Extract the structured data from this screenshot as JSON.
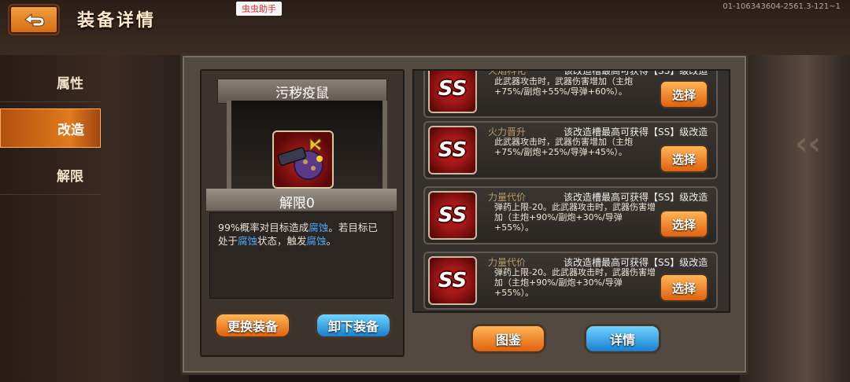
{
  "header": {
    "title": "装备详情",
    "back_icon": "return-arrow-icon",
    "helper_badge": "虫虫助手",
    "device_id": "01-106343604-2561.3-121~1"
  },
  "sidebar": {
    "tabs": [
      {
        "label": "属性",
        "active": false
      },
      {
        "label": "改造",
        "active": true
      },
      {
        "label": "解限",
        "active": false
      }
    ]
  },
  "equipment": {
    "name": "污秽疫鼠",
    "limit_break": "解限0",
    "description_parts": [
      "99%概率对目标造成",
      "腐蚀",
      "。若目标已处于",
      "腐蚀",
      "状态，触发",
      "腐蚀",
      "。"
    ],
    "keyword_color": "#4aa6ff",
    "change_button": "更换装备",
    "unequip_button": "卸下装备"
  },
  "mods": [
    {
      "name": "火焰科化",
      "slot": "该改造槽最高可获得【SS】级改造",
      "grade": "SS",
      "desc": "此武器攻击时，武器伤害增加（主炮+75%/副炮+55%/导弹+60%）。",
      "button": "选择"
    },
    {
      "name": "火力晋升",
      "slot": "该改造槽最高可获得【SS】级改造",
      "grade": "SS",
      "desc": "此武器攻击时，武器伤害增加（主炮+75%/副炮+25%/导弹+45%）。",
      "button": "选择"
    },
    {
      "name": "力量代价",
      "slot": "该改造槽最高可获得【SS】级改造",
      "grade": "SS",
      "desc": "弹药上限-20。此武器攻击时，武器伤害增加（主炮+90%/副炮+30%/导弹+55%）。",
      "button": "选择"
    },
    {
      "name": "力量代价",
      "slot": "该改造槽最高可获得【SS】级改造",
      "grade": "SS",
      "desc": "弹药上限-20。此武器攻击时，武器伤害增加（主炮+90%/副炮+30%/导弹+55%）。",
      "button": "选择"
    }
  ],
  "footer": {
    "catalog_button": "图鉴",
    "details_button": "详情"
  },
  "colors": {
    "accent_orange": "#e07a1c",
    "accent_blue": "#1780d0",
    "grade_red": "#a81818"
  }
}
